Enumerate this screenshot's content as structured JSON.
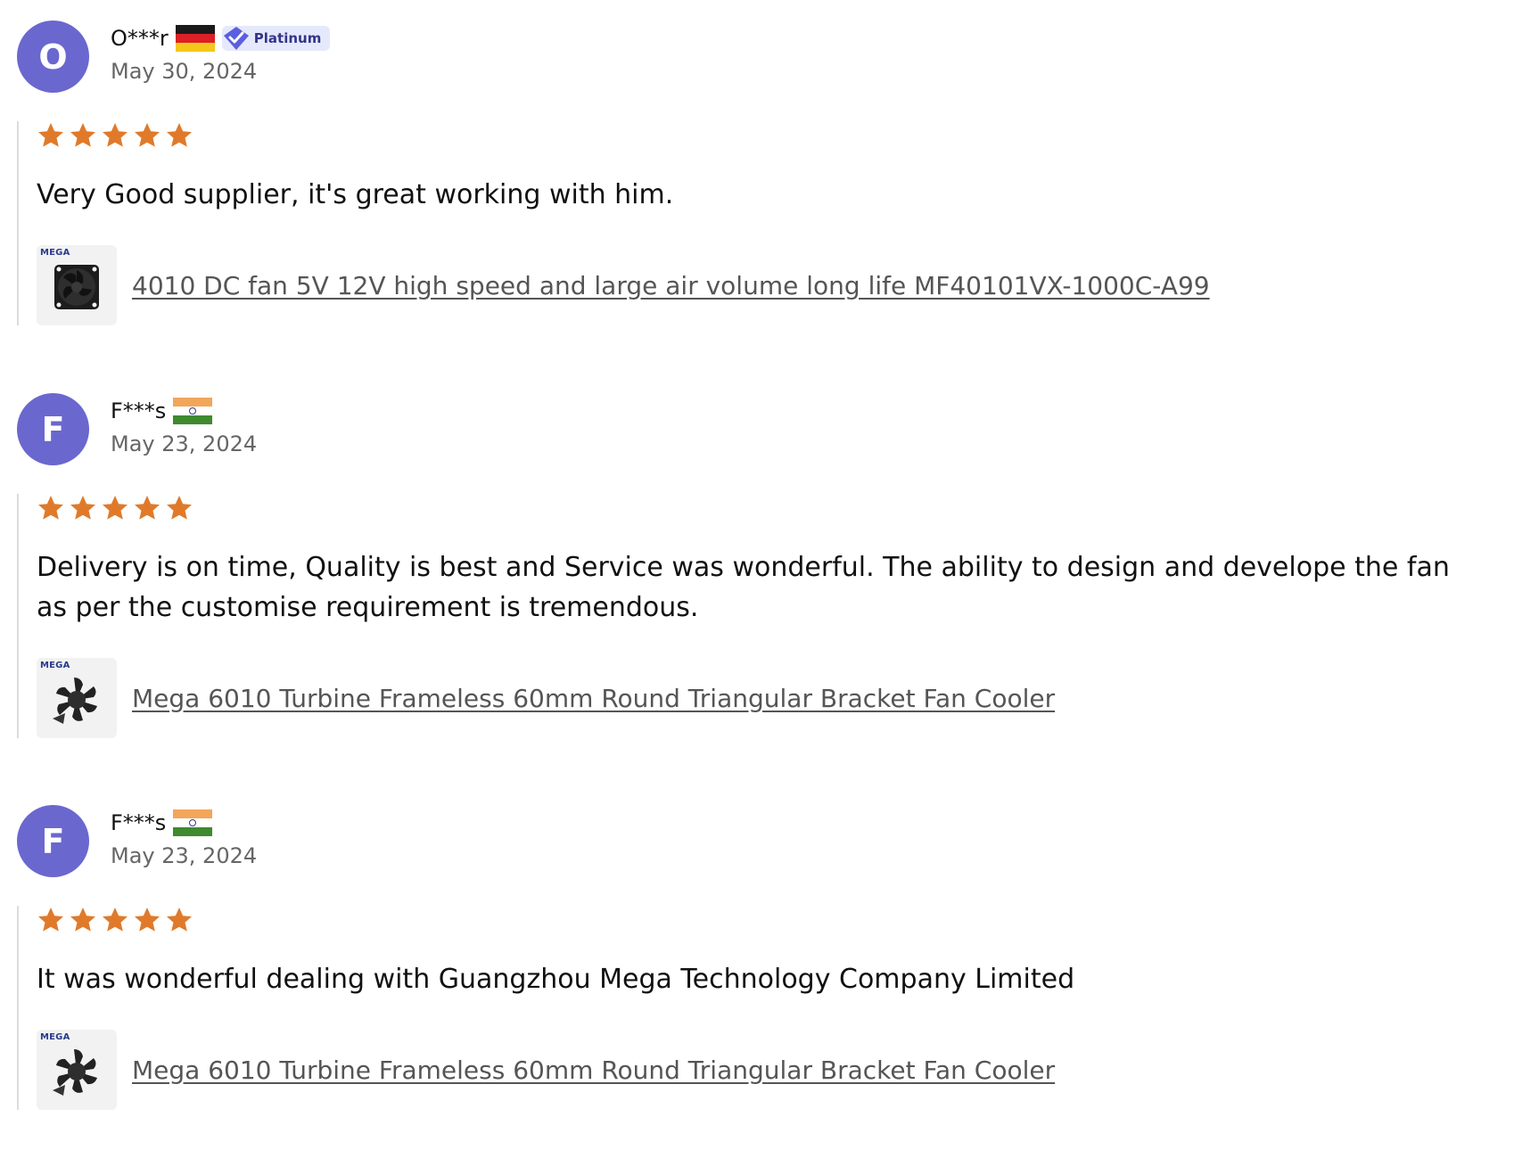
{
  "reviews": [
    {
      "avatar_letter": "O",
      "name": "O***r",
      "country_flag": "germany",
      "badge": "Platinum",
      "date": "May 30, 2024",
      "rating": 5,
      "text": "Very Good supplier, it's great working with him.",
      "product": {
        "thumb_logo": "MEGA",
        "title": "4010 DC fan 5V 12V high speed and large air volume long life MF40101VX-1000C-A99"
      }
    },
    {
      "avatar_letter": "F",
      "name": "F***s",
      "country_flag": "india",
      "date": "May 23, 2024",
      "rating": 5,
      "text": "Delivery is on time, Quality is best and Service was wonderful. The ability to design and develope the fan as per the customise requirement is tremendous.",
      "product": {
        "thumb_logo": "MEGA",
        "title": "Mega 6010 Turbine Frameless 60mm Round Triangular Bracket Fan Cooler"
      }
    },
    {
      "avatar_letter": "F",
      "name": "F***s",
      "country_flag": "india",
      "date": "May 23, 2024",
      "rating": 5,
      "text": "It was wonderful dealing with Guangzhou Mega Technology Company Limited",
      "product": {
        "thumb_logo": "MEGA",
        "title": "Mega 6010 Turbine Frameless 60mm Round Triangular Bracket Fan Cooler"
      }
    }
  ],
  "colors": {
    "avatar": "#6a67cf",
    "star": "#e07a2a",
    "badge_bg": "#e6e9fb",
    "badge_text": "#33358a"
  }
}
